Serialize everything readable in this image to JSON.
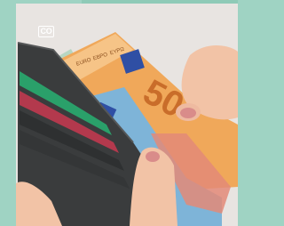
{
  "badge": {
    "label": "CO"
  },
  "banknote": {
    "denomination": "50",
    "currency_mark": "EURO",
    "cyrillic_mark": "EBPO",
    "greek_mark": "EYPΩ"
  },
  "colors": {
    "mint_border": "#9fd3c3",
    "backdrop": "#e8e4e1",
    "wallet": "#3a3c3d",
    "note_50": "#f0a85a",
    "note_20": "#7eb4d8",
    "note_10": "#e38a78",
    "note_5": "#b7d6c2"
  }
}
